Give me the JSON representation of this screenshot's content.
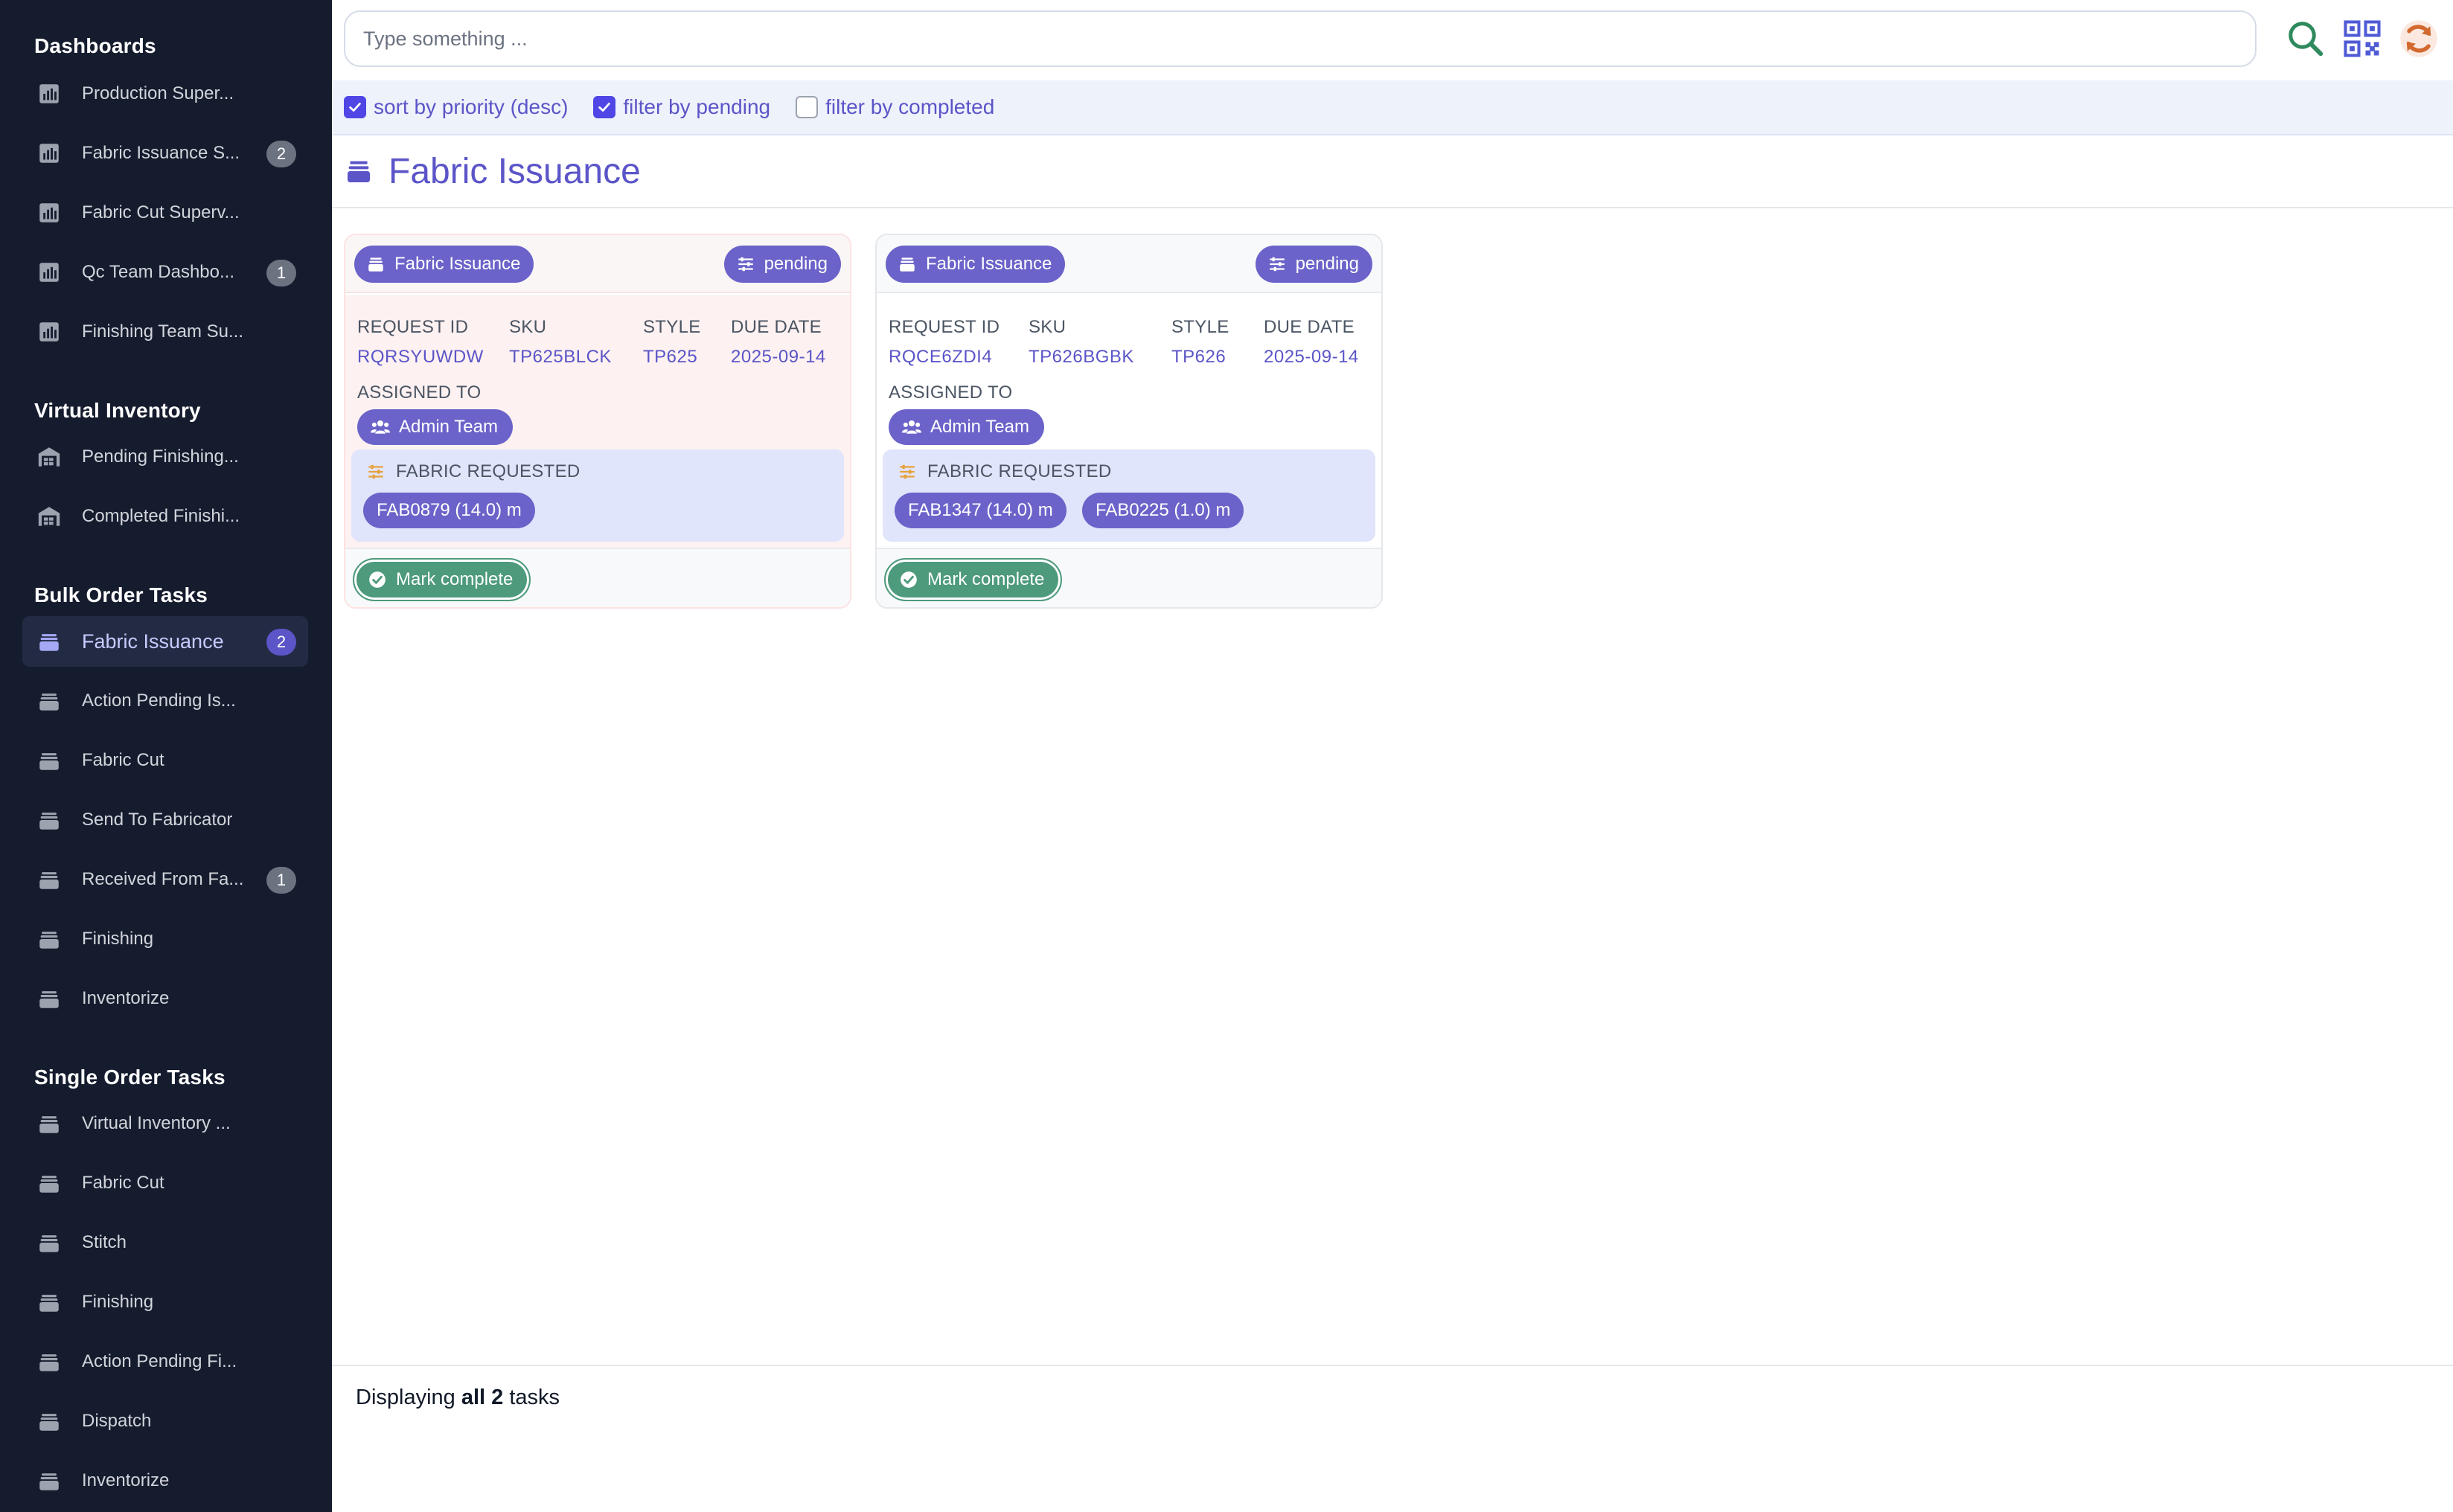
{
  "sidebar": {
    "sections": [
      {
        "title": "Dashboards",
        "items": [
          {
            "label": "Production Super...",
            "icon": "chart-icon",
            "badge": ""
          },
          {
            "label": "Fabric Issuance S...",
            "icon": "chart-icon",
            "badge": "2"
          },
          {
            "label": "Fabric Cut Superv...",
            "icon": "chart-icon",
            "badge": ""
          },
          {
            "label": "Qc Team Dashbo...",
            "icon": "chart-icon",
            "badge": "1"
          },
          {
            "label": "Finishing Team Su...",
            "icon": "chart-icon",
            "badge": ""
          }
        ]
      },
      {
        "title": "Virtual Inventory",
        "items": [
          {
            "label": "Pending Finishing...",
            "icon": "warehouse-icon",
            "badge": ""
          },
          {
            "label": "Completed Finishi...",
            "icon": "warehouse-icon",
            "badge": ""
          }
        ]
      },
      {
        "title": "Bulk Order Tasks",
        "items": [
          {
            "label": "Fabric Issuance",
            "icon": "stack-icon",
            "badge": "2",
            "active": true
          },
          {
            "label": "Action Pending Is...",
            "icon": "stack-icon",
            "badge": ""
          },
          {
            "label": "Fabric Cut",
            "icon": "stack-icon",
            "badge": ""
          },
          {
            "label": "Send To Fabricator",
            "icon": "stack-icon",
            "badge": ""
          },
          {
            "label": "Received From Fa...",
            "icon": "stack-icon",
            "badge": "1"
          },
          {
            "label": "Finishing",
            "icon": "stack-icon",
            "badge": ""
          },
          {
            "label": "Inventorize",
            "icon": "stack-icon",
            "badge": ""
          }
        ]
      },
      {
        "title": "Single Order Tasks",
        "items": [
          {
            "label": "Virtual Inventory ...",
            "icon": "stack-icon",
            "badge": ""
          },
          {
            "label": "Fabric Cut",
            "icon": "stack-icon",
            "badge": ""
          },
          {
            "label": "Stitch",
            "icon": "stack-icon",
            "badge": ""
          },
          {
            "label": "Finishing",
            "icon": "stack-icon",
            "badge": ""
          },
          {
            "label": "Action Pending Fi...",
            "icon": "stack-icon",
            "badge": ""
          },
          {
            "label": "Dispatch",
            "icon": "stack-icon",
            "badge": ""
          },
          {
            "label": "Inventorize",
            "icon": "stack-icon",
            "badge": ""
          }
        ]
      }
    ]
  },
  "topbar": {
    "search_placeholder": "Type something ...",
    "search_value": "",
    "icons": [
      "search-icon",
      "qr-code-icon",
      "refresh-icon"
    ]
  },
  "filters": [
    {
      "label": "sort by priority (desc)",
      "checked": true
    },
    {
      "label": "filter by pending",
      "checked": true
    },
    {
      "label": "filter by completed",
      "checked": false
    }
  ],
  "page": {
    "title": "Fabric Issuance",
    "icon": "stack-icon"
  },
  "labels": {
    "request_id": "REQUEST ID",
    "sku": "SKU",
    "style": "STYLE",
    "due_date": "DUE DATE",
    "assigned_to": "ASSIGNED TO",
    "fabric_requested": "FABRIC REQUESTED",
    "mark_complete": "Mark complete"
  },
  "tasks": [
    {
      "type": "Fabric Issuance",
      "status": "pending",
      "request_id": "RQRSYUWDW",
      "sku": "TP625BLCK",
      "style": "TP625",
      "due_date": "2025-09-14",
      "assigned_to": "Admin Team",
      "fabrics": [
        "FAB0879 (14.0) m"
      ],
      "highlighted": true
    },
    {
      "type": "Fabric Issuance",
      "status": "pending",
      "request_id": "RQCE6ZDI4",
      "sku": "TP626BGBK",
      "style": "TP626",
      "due_date": "2025-09-14",
      "assigned_to": "Admin Team",
      "fabrics": [
        "FAB1347 (14.0) m",
        "FAB0225 (1.0) m"
      ],
      "highlighted": false
    }
  ],
  "footer": {
    "prefix": "Displaying ",
    "emphasis": "all 2",
    "suffix": " tasks"
  },
  "colors": {
    "sidebar_bg": "#151c2e",
    "accent": "#5b55c8",
    "pill": "#6b63c9",
    "complete_button": "#4d9a7c",
    "filter_bar_bg": "#eef2fb"
  }
}
